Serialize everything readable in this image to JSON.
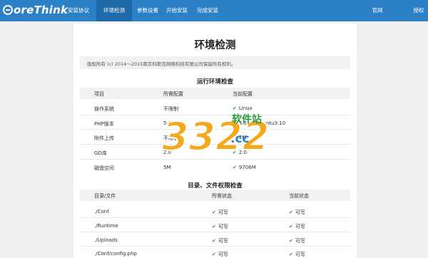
{
  "nav": {
    "logo": "oreThink",
    "items": [
      "安装协议",
      "环境检测",
      "参数设置",
      "开始安装",
      "完成安装"
    ],
    "right": [
      "官网",
      "授权"
    ]
  },
  "page": {
    "title": "环境检测",
    "copyright": "版权所有 (c) 2014～2015南京科斯克网络科技有限公司保留所有权利。"
  },
  "env": {
    "title": "运行环境检查",
    "headers": [
      "项目",
      "所需配置",
      "当前配置"
    ],
    "rows": [
      {
        "item": "操作系统",
        "required": "不限制",
        "current": "Linux"
      },
      {
        "item": "PHP版本",
        "required": "5.3",
        "current": "5.5.9-1ubuntu3.10"
      },
      {
        "item": "附件上传",
        "required": "不限制",
        "current": "2M"
      },
      {
        "item": "GD库",
        "required": "2.0",
        "current": "2.0"
      },
      {
        "item": "磁盘空间",
        "required": "5M",
        "current": "9706M"
      }
    ]
  },
  "dirs": {
    "title": "目录、文件权限检查",
    "headers": [
      "目录/文件",
      "所需状态",
      "当前状态"
    ],
    "rows": [
      {
        "path": "./Conf",
        "required": "可写",
        "current": "可写"
      },
      {
        "path": "./Runtime",
        "required": "可写",
        "current": "可写"
      },
      {
        "path": "./Uploads",
        "required": "可写",
        "current": "可写"
      },
      {
        "path": "./Conf/config.php",
        "required": "可写",
        "current": "可写"
      }
    ]
  },
  "watermark": {
    "text": "3322",
    "sub": "软件站",
    "cc": ".cc"
  },
  "colors": {
    "accent": "#2c80c6",
    "active": "#1f6aa8",
    "check": "#2f9a3b"
  }
}
